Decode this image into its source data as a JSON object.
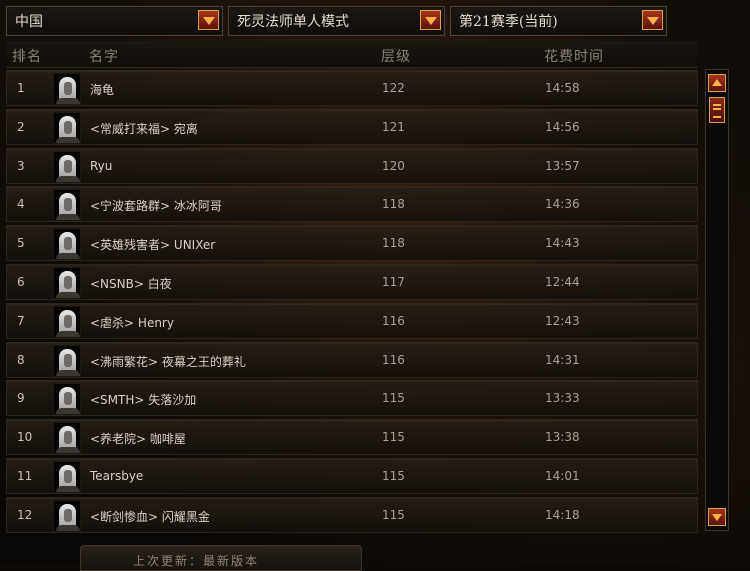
{
  "filters": {
    "region": "中国",
    "class_mode": "死灵法师单人模式",
    "season": "第21赛季(当前)"
  },
  "columns": {
    "rank": "排名",
    "name": "名字",
    "level": "层级",
    "time": "花费时间"
  },
  "rows": [
    {
      "rank": "1",
      "name": "海龟",
      "level": "122",
      "time": "14:58"
    },
    {
      "rank": "2",
      "name": "<常威打来福> 宛离",
      "level": "121",
      "time": "14:56"
    },
    {
      "rank": "3",
      "name": "Ryu",
      "level": "120",
      "time": "13:57"
    },
    {
      "rank": "4",
      "name": "<宁波套路群> 冰冰阿哥",
      "level": "118",
      "time": "14:36"
    },
    {
      "rank": "5",
      "name": "<英雄残害者> UNIXer",
      "level": "118",
      "time": "14:43"
    },
    {
      "rank": "6",
      "name": "<NSNB> 白夜",
      "level": "117",
      "time": "12:44"
    },
    {
      "rank": "7",
      "name": "<虐杀> Henry",
      "level": "116",
      "time": "12:43"
    },
    {
      "rank": "8",
      "name": "<沸雨繁花> 夜幕之王的葬礼",
      "level": "116",
      "time": "14:31"
    },
    {
      "rank": "9",
      "name": "<SMTH> 失落沙加",
      "level": "115",
      "time": "13:33"
    },
    {
      "rank": "10",
      "name": "<养老院> 咖啡屋",
      "level": "115",
      "time": "13:38"
    },
    {
      "rank": "11",
      "name": "Tearsbye",
      "level": "115",
      "time": "14:01"
    },
    {
      "rank": "12",
      "name": "<断剑惨血> 闪耀黑金",
      "level": "115",
      "time": "14:18"
    }
  ],
  "footer": {
    "text": "上次更新：最新版本"
  },
  "icons": {
    "dropdown": "chevron-down-icon",
    "scroll_up": "arrow-up-icon",
    "scroll_down": "arrow-down-icon",
    "avatar": "necromancer-portrait-icon"
  },
  "colors": {
    "accent": "#a8341a",
    "accent_border": "#d7a24e",
    "arrow": "#ffb04a"
  }
}
